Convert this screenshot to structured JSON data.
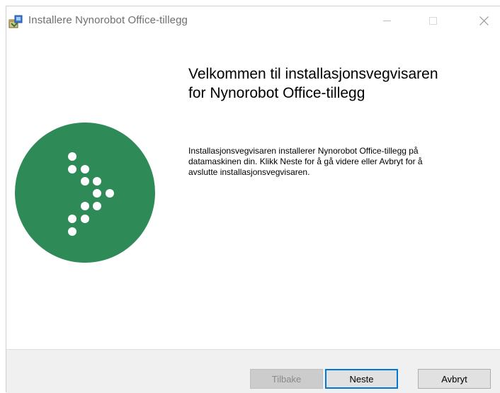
{
  "window": {
    "title": "Installere Nynorobot Office-tillegg",
    "icon": "installer-package-icon",
    "controls": {
      "minimize": "minimize-icon",
      "maximize": "maximize-icon",
      "close": "close-icon"
    }
  },
  "welcome": {
    "heading_line1": "Velkommen til installasjonsvegvisaren",
    "heading_line2": "for Nynorobot Office-tillegg",
    "body_line1": "Installasjonsvegvisaren installerer Nynorobot Office-tillegg på",
    "body_line2": "datamaskinen din. Klikk Neste for å gå videre eller Avbryt for å",
    "body_line3": "avslutte installasjonsvegvisaren."
  },
  "logo": {
    "icon": "nynorobot-arrow-logo",
    "circle_color": "#2e8b57",
    "dot_color": "#ffffff"
  },
  "buttons": {
    "back": "Tilbake",
    "back_enabled": false,
    "next": "Neste",
    "cancel": "Avbryt"
  },
  "colors": {
    "focus_border": "#0078d7",
    "footer_bg": "#f0f0f0"
  }
}
